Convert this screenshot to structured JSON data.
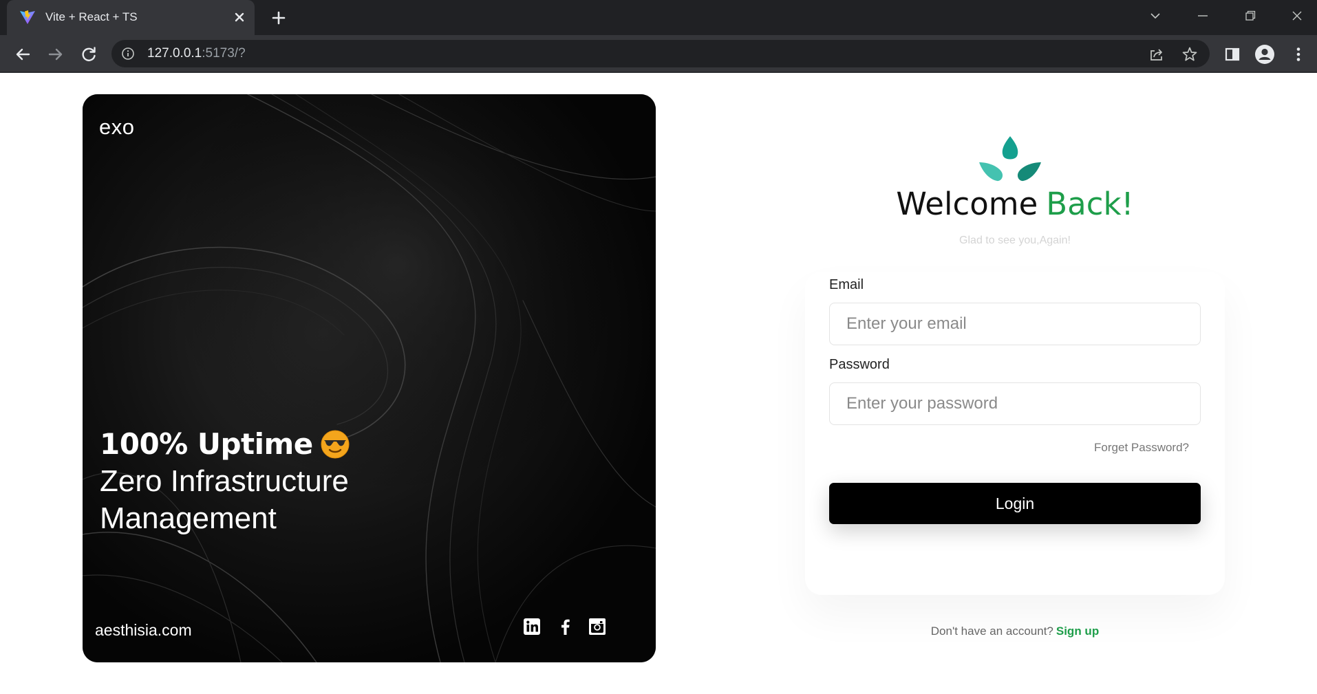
{
  "browser": {
    "tab_title": "Vite + React + TS",
    "url_host": "127.0.0.1",
    "url_rest": ":5173/?"
  },
  "hero": {
    "brand": "exo",
    "headline_bold": "100% Uptime",
    "headline_emoji": "smiling-face-with-sunglasses",
    "headline_line2": "Zero Infrastructure",
    "headline_line3": "Management",
    "site": "aesthisia.com",
    "social_icons": [
      "linkedin-icon",
      "facebook-icon",
      "instagram-icon"
    ]
  },
  "login": {
    "title_part1": "Welcome",
    "title_part2": "Back!",
    "subtitle": "Glad to see you,Again!",
    "email_label": "Email",
    "email_placeholder": "Enter your email",
    "password_label": "Password",
    "password_placeholder": "Enter your password",
    "forgot_label": "Forget Password?",
    "login_label": "Login",
    "signup_prompt": "Don't have an account?",
    "signup_label": "Sign up"
  },
  "colors": {
    "accent_green": "#1e9e4a",
    "logo_teal_top": "#14a08f",
    "logo_teal_left": "#44c2b0",
    "logo_teal_right": "#158a78",
    "chrome_dark": "#202124",
    "chrome_mid": "#35363a"
  }
}
